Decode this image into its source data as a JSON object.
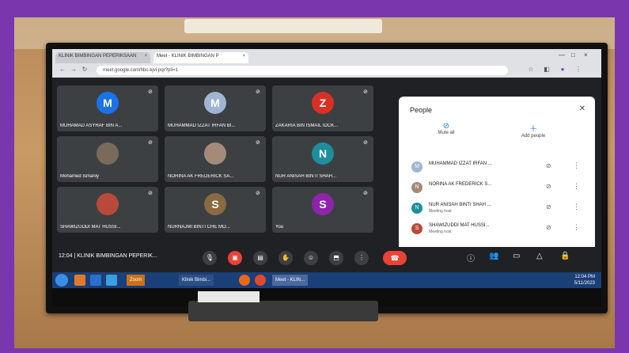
{
  "browser": {
    "tabs": [
      "KLINIK BIMBINGAN PEPERIKSAAN",
      "Meet - KLINIK BIMBINGAN P"
    ],
    "address": "meet.google.com/hbc-kjvi-pqr?pli=1"
  },
  "tiles": [
    {
      "initial": "M",
      "name": "MUHAMAD ASYRAF BIN A...",
      "color": "#1a73e8"
    },
    {
      "initial": "M",
      "name": "MUHAMMAD IZZAT IRFAN BI...",
      "color": "#9fb5d4"
    },
    {
      "initial": "Z",
      "name": "ZAKARIA BIN ISMAIL IDCK...",
      "color": "#d93025"
    },
    {
      "initial": "",
      "name": "Mohamed Ismanly",
      "color": "#7a6a5a"
    },
    {
      "initial": "",
      "name": "NORINA AK FREDERICK SA...",
      "color": "#a58a7a"
    },
    {
      "initial": "N",
      "name": "NUR ANISAH BINTI SHAH...",
      "color": "#1e8e9e"
    },
    {
      "initial": "",
      "name": "SHAWIZUDDI MAT HUSSI...",
      "color": "#b84a3a"
    },
    {
      "initial": "S",
      "name": "NURNAJMI BINTI CHE MO...",
      "color": "#8a6a40"
    },
    {
      "initial": "S",
      "name": "You",
      "color": "#8e24aa"
    }
  ],
  "people_panel": {
    "title": "People",
    "close_icon": "close-icon",
    "mute_all": "Mute all",
    "add_people": "Add people",
    "rows": [
      {
        "initial": "M",
        "name": "MUHAMMAD IZZAT IRFAN ...",
        "sub": "",
        "color": "#9fb5d4"
      },
      {
        "initial": "N",
        "name": "NORINA AK FREDERICK S...",
        "sub": "",
        "color": "#a58a7a"
      },
      {
        "initial": "N",
        "name": "NUR ANISAH BINTI SHAH ...",
        "sub": "Meeting host",
        "color": "#1e8e9e"
      },
      {
        "initial": "S",
        "name": "SHAWIZUDDI MAT HUSSI...",
        "sub": "Meeting host",
        "color": "#b84a3a"
      }
    ]
  },
  "bottombar": {
    "clock": "12:04",
    "meeting_name": "KLINIK BIMBINGAN PEPERIK..."
  },
  "taskbar": {
    "time": "12:04 PM",
    "date": "5/11/2023",
    "tasks": [
      "Zoom",
      "Klinik Bimbi...",
      "Meet - KLIN..."
    ]
  }
}
